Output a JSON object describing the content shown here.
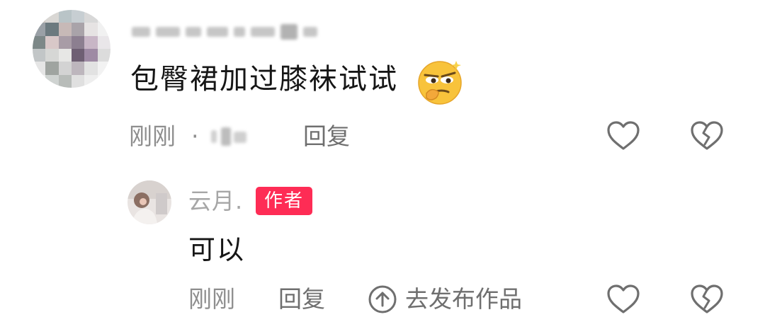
{
  "comment": {
    "text": "包臀裙加过膝袜试试",
    "time": "刚刚",
    "separator": "·",
    "reply_label": "回复",
    "emoji_icon": "smirk-emoji-icon"
  },
  "reply": {
    "author_name": "云月.",
    "author_badge": "作者",
    "text": "可以",
    "time": "刚刚",
    "reply_label": "回复",
    "publish_label": "去发布作品"
  },
  "icons": {
    "like": "heart-outline-icon",
    "dislike": "broken-heart-icon",
    "publish": "arrow-up-circle-icon"
  },
  "colors": {
    "badge": "#fe2c55",
    "text": "#161616",
    "meta": "#8e8e8e",
    "icon_stroke": "#6f6f6f"
  }
}
